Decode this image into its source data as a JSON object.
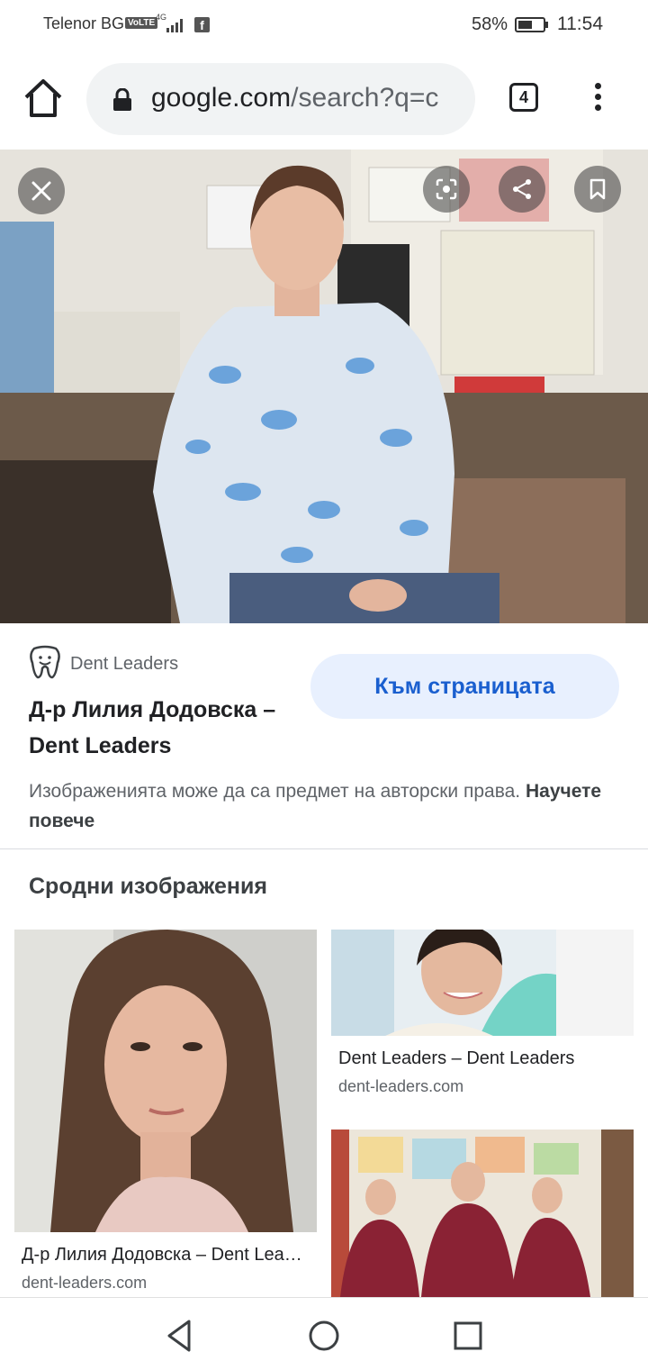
{
  "status_bar": {
    "carrier": "Telenor BG",
    "volte": "VoLTE",
    "network": "4G",
    "facebook_icon": "facebook-icon",
    "battery_percent": "58%",
    "battery_level": 0.58,
    "time": "11:54"
  },
  "toolbar": {
    "home_icon": "home-icon",
    "url_host": "google.com",
    "url_path": "/search?q=c",
    "lock_icon": "lock-icon",
    "tab_count": "4",
    "menu_icon": "more-vert-icon"
  },
  "viewer": {
    "close_icon": "close-icon",
    "lens_icon": "lens-icon",
    "share_icon": "share-icon",
    "bookmark_icon": "bookmark-icon"
  },
  "result": {
    "source_icon": "tooth-icon",
    "source": "Dent Leaders",
    "title": "Д-р Лилия Додовска – Dent Leaders",
    "visit_button": "Към страницата",
    "copyright_text": "Изображенията може да са предмет на авторски права.",
    "learn_more": "Научете повече"
  },
  "related": {
    "heading": "Сродни изображения",
    "items": [
      {
        "title": "Д-р Лилия Додовска – Dent Leaders",
        "domain": "dent-leaders.com"
      },
      {
        "title": "Dent Leaders – Dent Leaders",
        "domain": "dent-leaders.com"
      },
      {
        "title": "",
        "domain": ""
      }
    ]
  },
  "nav_bar": {
    "back_icon": "back-triangle-icon",
    "home_icon": "home-circle-icon",
    "recents_icon": "recents-square-icon"
  },
  "colors": {
    "accent": "#1a5fcf",
    "button_bg": "#e8f0fe",
    "url_bar_bg": "#f1f3f4"
  }
}
